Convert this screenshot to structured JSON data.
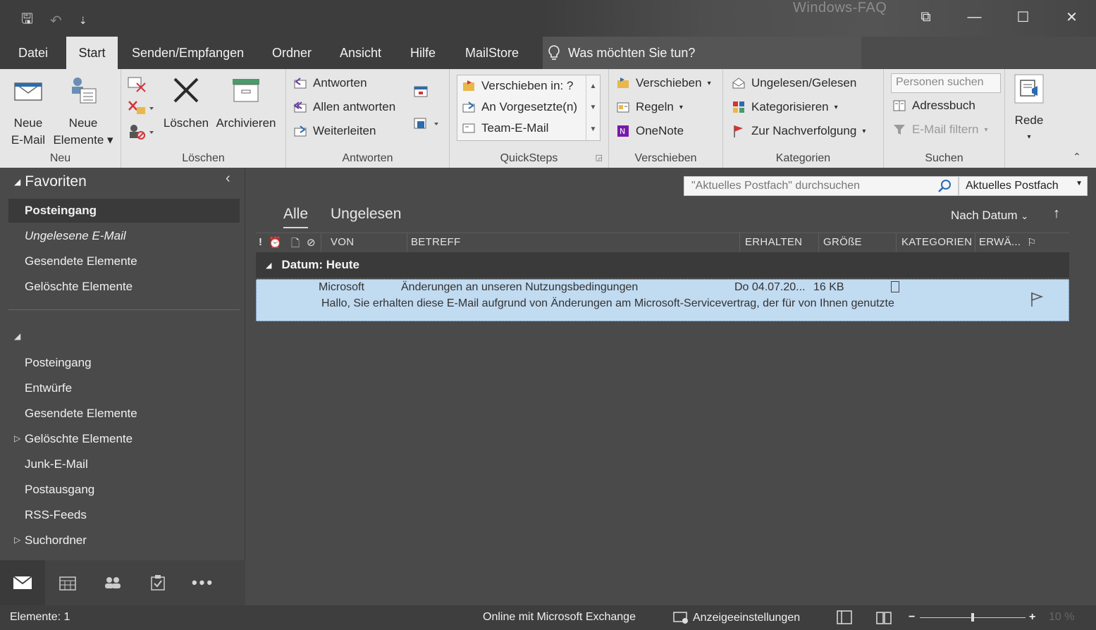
{
  "window": {
    "watermark": "Windows-FAQ",
    "controls": {
      "ribbon_display": "⧉",
      "minimize": "—",
      "maximize": "☐",
      "close": "✕"
    }
  },
  "qat": {
    "save": "🖫",
    "undo": "↶",
    "customize": "⇣"
  },
  "menu": {
    "tabs": [
      "Datei",
      "Start",
      "Senden/Empfangen",
      "Ordner",
      "Ansicht",
      "Hilfe",
      "MailStore"
    ],
    "active": "Start",
    "tellme": "Was möchten Sie tun?"
  },
  "ribbon": {
    "neu": {
      "label": "Neu",
      "new_email_l1": "Neue",
      "new_email_l2": "E-Mail",
      "new_items_l1": "Neue",
      "new_items_l2": "Elemente ▾"
    },
    "loeschen": {
      "label": "Löschen",
      "delete": "Löschen",
      "archive": "Archivieren"
    },
    "antworten": {
      "label": "Antworten",
      "reply": "Antworten",
      "reply_all": "Allen antworten",
      "forward": "Weiterleiten"
    },
    "quicksteps": {
      "label": "QuickSteps",
      "items": [
        "Verschieben in: ?",
        "An Vorgesetzte(n)",
        "Team-E-Mail"
      ]
    },
    "verschieben": {
      "label": "Verschieben",
      "move": "Verschieben",
      "rules": "Regeln",
      "onenote": "OneNote"
    },
    "kategorien": {
      "label": "Kategorien",
      "unread_read": "Ungelesen/Gelesen",
      "categorize": "Kategorisieren",
      "followup": "Zur Nachverfolgung"
    },
    "suchen": {
      "label": "Suchen",
      "people_placeholder": "Personen suchen",
      "address_book": "Adressbuch",
      "filter_email": "E-Mail filtern"
    },
    "rede": {
      "label": "Rede"
    }
  },
  "nav": {
    "favorites_header": "Favoriten",
    "favorites": [
      "Posteingang",
      "Ungelesene E-Mail",
      "Gesendete Elemente",
      "Gelöschte Elemente"
    ],
    "folders": [
      "Posteingang",
      "Entwürfe",
      "Gesendete Elemente",
      "Gelöschte Elemente",
      "Junk-E-Mail",
      "Postausgang",
      "RSS-Feeds",
      "Suchordner"
    ]
  },
  "search": {
    "placeholder": "\"Aktuelles Postfach\" durchsuchen",
    "scope": "Aktuelles Postfach"
  },
  "list": {
    "tabs": {
      "all": "Alle",
      "unread": "Ungelesen"
    },
    "sort": "Nach Datum",
    "columns": {
      "from": "VON",
      "subject": "BETREFF",
      "received": "ERHALTEN",
      "size": "GRÖßE",
      "categories": "KATEGORIEN",
      "reminder": "ERWÄ..."
    },
    "group": "Datum: Heute",
    "message": {
      "from": "Microsoft",
      "subject": "Änderungen an unseren Nutzungsbedingungen",
      "received": "Do 04.07.20...",
      "size": "16 KB",
      "preview": "Hallo,  Sie erhalten diese E-Mail aufgrund von Änderungen am Microsoft-Servicevertrag, der für von Ihnen genutzte"
    }
  },
  "status": {
    "items": "Elemente: 1",
    "connection": "Online mit Microsoft Exchange",
    "display_settings": "Anzeigeeinstellungen",
    "zoom": "10 %"
  },
  "colors": {
    "accent": "#c1dbf1",
    "ribbon": "#e6e6e6",
    "dark": "#4a4a4a",
    "flag_red": "#d13438"
  }
}
